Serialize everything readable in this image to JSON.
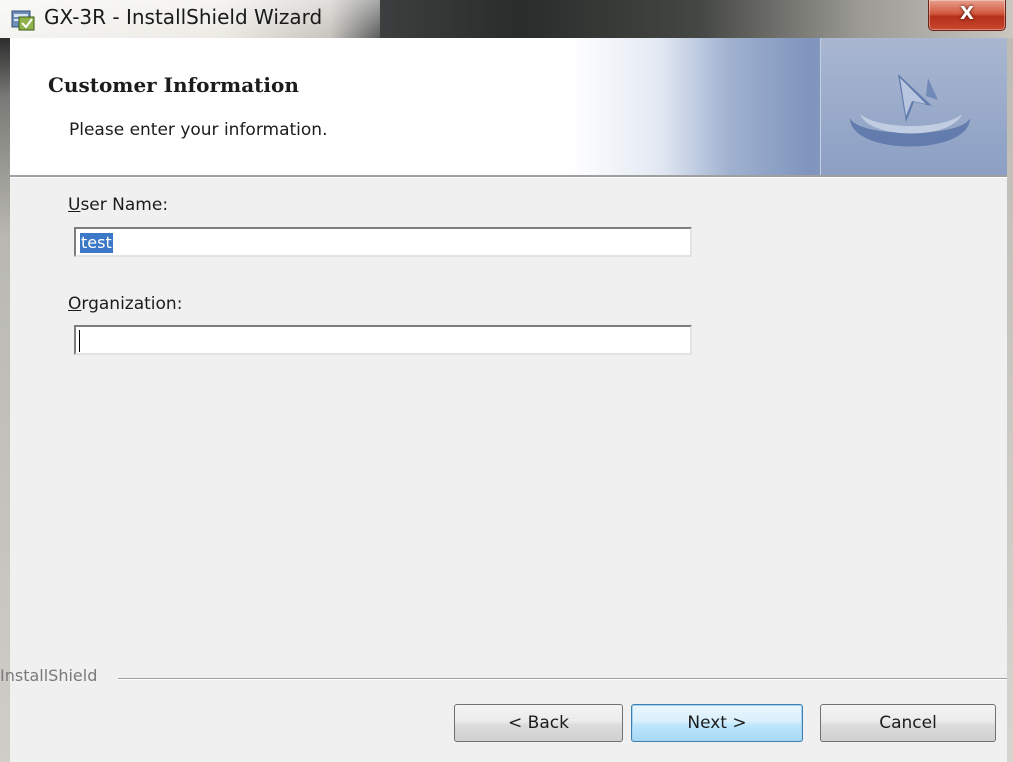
{
  "window": {
    "title": "GX-3R - InstallShield Wizard",
    "close_glyph": "X"
  },
  "header": {
    "title": "Customer Information",
    "subtitle": "Please enter your information."
  },
  "form": {
    "user_name": {
      "label_accel": "U",
      "label_rest": "ser Name:",
      "value": "test"
    },
    "organization": {
      "label_accel": "O",
      "label_rest": "rganization:",
      "value": ""
    }
  },
  "footer": {
    "brand": "InstallShield",
    "back_label": "< Back",
    "next_label": "Next >",
    "cancel_label": "Cancel"
  },
  "icons": {
    "app_icon": "installer-icon",
    "banner_logo": "installshield-logo-icon",
    "close": "close-icon"
  },
  "colors": {
    "selection": "#3b78c7",
    "close_button": "#c8482d",
    "default_button_border": "#3c7fb1"
  }
}
